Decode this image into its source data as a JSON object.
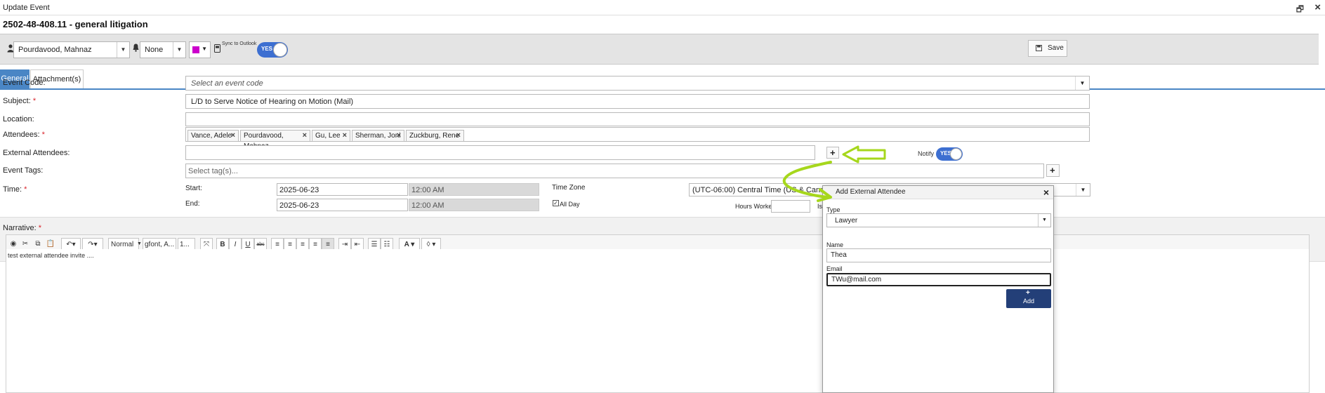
{
  "window": {
    "title": "Update Event"
  },
  "header": {
    "title": "2502-48-408.11 - general litigation"
  },
  "toolbar": {
    "owner": "Pourdavood, Mahnaz",
    "reminder": "None",
    "color": "#cc00cc",
    "sync_label": "Sync to Outlook",
    "sync_toggle": "YES",
    "save_label": "Save"
  },
  "tabs": [
    {
      "label": "General",
      "active": true
    },
    {
      "label": "Attachment(s)",
      "active": false
    }
  ],
  "form": {
    "event_code": {
      "label": "Event Code:",
      "placeholder": "Select an event code"
    },
    "subject": {
      "label": "Subject:",
      "required_mark": "*",
      "value": "L/D to Serve Notice of Hearing on Motion (Mail)"
    },
    "location": {
      "label": "Location:",
      "value": ""
    },
    "attendees": {
      "label": "Attendees:",
      "required_mark": "*",
      "chips": [
        "Vance, Adele",
        "Pourdavood, Mahnaz",
        "Gu, Lee",
        "Sherman, Joni",
        "Zuckburg, Rene"
      ],
      "remove_glyph": "×"
    },
    "external_attendees": {
      "label": "External Attendees:",
      "value": "",
      "add_glyph": "+"
    },
    "notify": {
      "label": "Notify",
      "toggle": "YES"
    },
    "event_tags": {
      "label": "Event Tags:",
      "placeholder": "Select tag(s)...",
      "add_glyph": "+"
    },
    "time": {
      "label": "Time:",
      "required_mark": "*",
      "start_label": "Start:",
      "start_date": "2025-06-23",
      "start_time": "12:00 AM",
      "end_label": "End:",
      "end_date": "2025-06-23",
      "end_time": "12:00 AM",
      "timezone_label": "Time Zone",
      "timezone_value": "(UTC-06:00) Central Time (US & Canada)",
      "all_day_label": "All Day",
      "all_day_checked": true,
      "hours_worked_label": "Hours Worked",
      "hours_worked_value": "",
      "partial_label": "Is"
    },
    "narrative": {
      "label": "Narrative:",
      "required_mark": "*",
      "style_select": "Normal",
      "font_select": "gfont, A...",
      "size_select": "1...",
      "text": "test external attendee invite ...."
    }
  },
  "popup": {
    "title": "Add External Attendee",
    "close_glyph": "×",
    "type_label": "Type",
    "type_value": "Lawyer",
    "name_label": "Name",
    "name_value": "Thea",
    "email_label": "Email",
    "email_value": "TWu@mail.com",
    "add_glyph": "+",
    "add_label": "Add"
  },
  "annotation": {
    "color": "#a6d71c"
  },
  "icons": {
    "user": "user-icon",
    "bell": "bell-icon",
    "outlook": "outlook-icon",
    "save": "save-icon"
  }
}
